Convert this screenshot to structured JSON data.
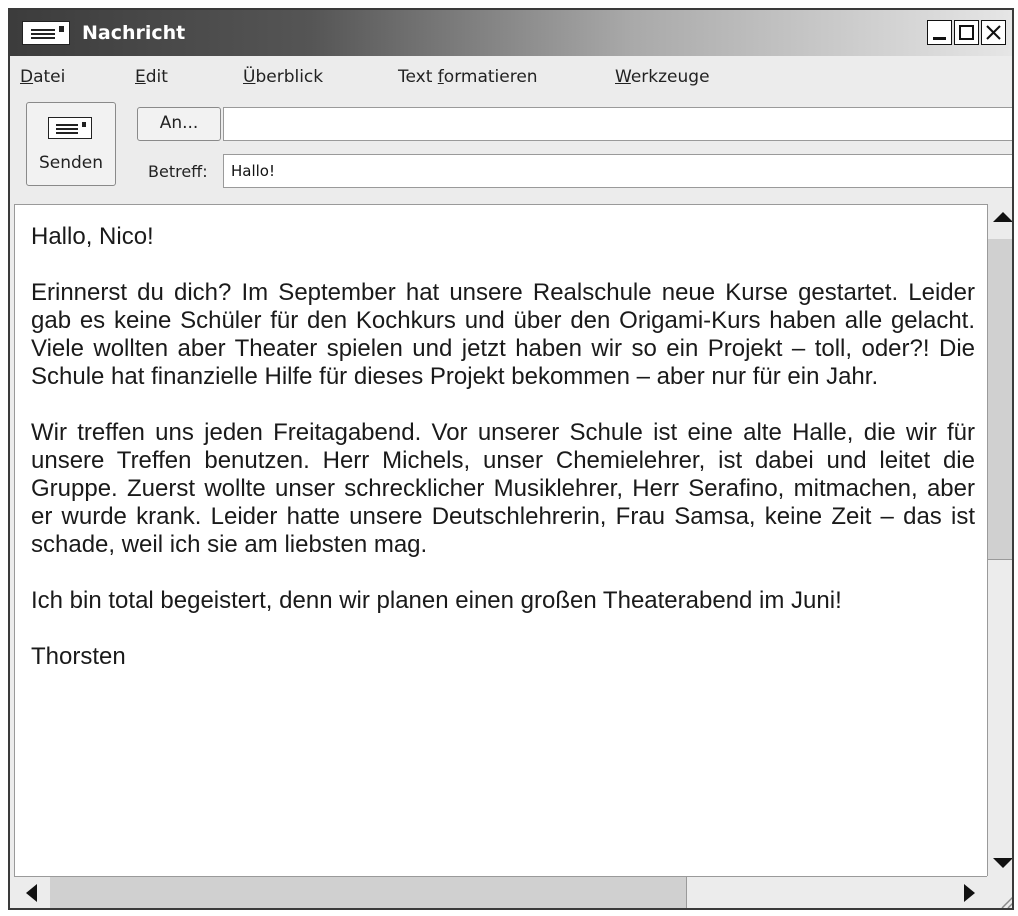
{
  "window": {
    "title": "Nachricht"
  },
  "menu": [
    {
      "prefix": "",
      "underline": "D",
      "suffix": "atei"
    },
    {
      "prefix": "",
      "underline": "E",
      "suffix": "dit"
    },
    {
      "prefix": "",
      "underline": "Ü",
      "suffix": "berblick"
    },
    {
      "prefix": "Text ",
      "underline": "f",
      "suffix": "ormatieren"
    },
    {
      "prefix": "",
      "underline": "W",
      "suffix": "erkzeuge"
    }
  ],
  "toolbar": {
    "send_label": "Senden",
    "to_button": "An...",
    "to_value": "",
    "subject_label": "Betreff:",
    "subject_value": "Hallo!"
  },
  "message": {
    "paragraphs": [
      "Hallo, Nico!",
      "Erinnerst du dich? Im September hat unsere Realschule neue Kurse gestartet. Leider gab es keine Schüler für den Kochkurs und über den Origami-Kurs haben alle gelacht. Viele wollten aber Theater spielen und jetzt haben wir so ein Projekt – toll, oder?! Die Schule hat finanzielle Hilfe für dieses Projekt bekommen – aber nur für ein Jahr.",
      "Wir treffen uns jeden Freitagabend. Vor unserer Schule ist eine alte Halle, die wir für unsere Treffen benutzen. Herr Michels, unser Chemielehrer, ist dabei und leitet die Gruppe. Zuerst wollte unser schrecklicher Musiklehrer, Herr Serafino, mitmachen, aber er wurde krank. Leider hatte unsere Deutschlehrerin, Frau Samsa, keine Zeit – das ist schade, weil ich sie am liebsten mag.",
      "Ich bin total begeistert, denn wir planen einen großen Theaterabend im Juni!",
      "Thorsten"
    ]
  },
  "icons": {
    "title": "envelope-icon",
    "send": "envelope-icon"
  }
}
